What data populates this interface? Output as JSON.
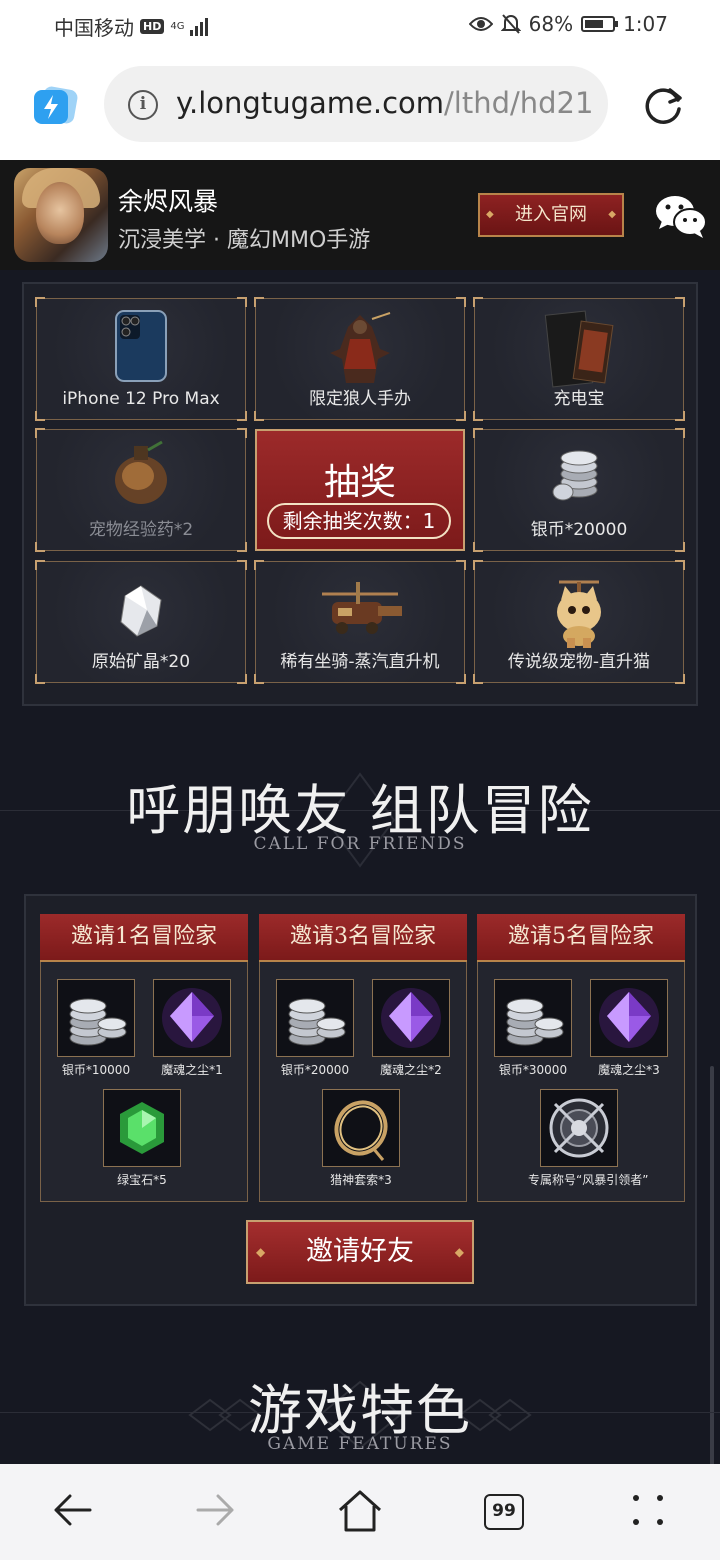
{
  "status_bar": {
    "carrier": "中国移动",
    "hd": "HD",
    "network": "4G",
    "battery": "68%",
    "battery_level": 0.68,
    "time": "1:07"
  },
  "browser": {
    "url_domain": "y.longtugame.com",
    "url_path": "/lthd/hd21",
    "info_icon": "i",
    "tabs_count": "99"
  },
  "app_banner": {
    "name": "余烬风暴",
    "subtitle": "沉浸美学 · 魔幻MMO手游",
    "enter_button": "进入官网"
  },
  "prizes": [
    {
      "label": "iPhone 12 Pro Max",
      "icon": "phone-icon"
    },
    {
      "label": "限定狼人手办",
      "icon": "figure-icon"
    },
    {
      "label": "充电宝",
      "icon": "powerbank-icon"
    },
    {
      "label": "宠物经验药*2",
      "icon": "potion-icon"
    },
    {
      "label": "银币*20000",
      "icon": "coins-icon"
    },
    {
      "label": "原始矿晶*20",
      "icon": "crystal-icon"
    },
    {
      "label": "稀有坐骑-蒸汽直升机",
      "icon": "helicopter-icon"
    },
    {
      "label": "传说级宠物-直升猫",
      "icon": "cat-icon"
    }
  ],
  "draw": {
    "title": "抽奖",
    "remaining": "剩余抽奖次数：1"
  },
  "friends_section": {
    "title": "呼朋唤友 组队冒险",
    "subtitle": "CALL FOR FRIENDS"
  },
  "invite_tiers": [
    {
      "title": "邀请1名冒险家",
      "items": [
        {
          "label": "银币*10000",
          "icon": "coins-icon"
        },
        {
          "label": "魔魂之尘*1",
          "icon": "purple-gem-icon"
        },
        {
          "label": "绿宝石*5",
          "icon": "emerald-icon"
        }
      ]
    },
    {
      "title": "邀请3名冒险家",
      "items": [
        {
          "label": "银币*20000",
          "icon": "coins-icon"
        },
        {
          "label": "魔魂之尘*2",
          "icon": "purple-gem-icon"
        },
        {
          "label": "猎神套索*3",
          "icon": "lasso-icon"
        }
      ]
    },
    {
      "title": "邀请5名冒险家",
      "items": [
        {
          "label": "银币*30000",
          "icon": "coins-icon"
        },
        {
          "label": "魔魂之尘*3",
          "icon": "purple-gem-icon"
        },
        {
          "label": "专属称号“风暴引领者”",
          "icon": "emblem-icon"
        }
      ]
    }
  ],
  "invite_button": "邀请好友",
  "features_section": {
    "title": "游戏特色",
    "subtitle": "GAME FEATURES"
  },
  "colors": {
    "page_bg": "#161822",
    "accent_red": "#8e2222",
    "gold": "#c7a070"
  }
}
